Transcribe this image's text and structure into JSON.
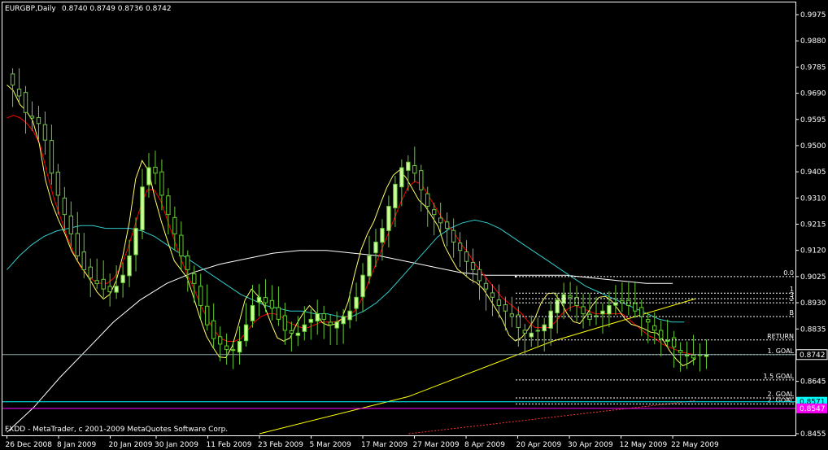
{
  "window": {
    "symbol_header": "EURGBP,Daily",
    "ohlc_header": "0.8740 0.8749 0.8736 0.8742",
    "copyright": "FXDD - MetaTrader, c 2001-2009 MetaQuotes Software Corp."
  },
  "colors": {
    "background": "#000000",
    "frame": "#ffffff",
    "bull_candle": "#ccff99",
    "bear_candle": "#000000",
    "wick": "#66cc33",
    "ma_red": "#ff0000",
    "ma_yellow": "#ffff66",
    "ma_cyan": "#33cccc",
    "ma_white": "#ffffff",
    "ma_long": "#ffff00",
    "bid_line": "#8aa5a5",
    "level_price_bg": "#00ffff",
    "level_magenta": "#ff00ff",
    "fib_line": "#ffffff",
    "projection": "#ff3333"
  },
  "chart_data": {
    "type": "candlestick",
    "symbol": "EURGBP",
    "timeframe": "Daily",
    "y_ticks": [
      0.9975,
      0.988,
      0.9785,
      0.969,
      0.9595,
      0.95,
      0.9405,
      0.931,
      0.9215,
      0.912,
      0.9025,
      0.893,
      0.8835,
      0.8645,
      0.8455
    ],
    "y_tick_labels": [
      "0.9975",
      "0.9880",
      "0.9785",
      "0.9690",
      "0.9595",
      "0.9500",
      "0.9405",
      "0.9310",
      "0.9215",
      "0.9120",
      "0.9025",
      "0.8930",
      "0.8835",
      "0.8645",
      "0.8455"
    ],
    "ylim": [
      0.8455,
      0.9995
    ],
    "x_labels": [
      "26 Dec 2008",
      "8 Jan 2009",
      "20 Jan 2009",
      "30 Jan 2009",
      "11 Feb 2009",
      "23 Feb 2009",
      "5 Mar 2009",
      "17 Mar 2009",
      "27 Mar 2009",
      "8 Apr 2009",
      "20 Apr 2009",
      "30 Apr 2009",
      "12 May 2009",
      "22 May 2009"
    ],
    "x_label_bars": [
      0,
      9,
      18,
      26,
      35,
      44,
      53,
      62,
      71,
      80,
      89,
      98,
      107,
      116
    ],
    "bar_count": 124,
    "close": [
      0.972,
      0.968,
      0.962,
      0.96,
      0.958,
      0.952,
      0.94,
      0.932,
      0.925,
      0.918,
      0.91,
      0.905,
      0.902,
      0.9,
      0.898,
      0.897,
      0.899,
      0.903,
      0.91,
      0.92,
      0.935,
      0.942,
      0.94,
      0.932,
      0.925,
      0.918,
      0.91,
      0.905,
      0.9,
      0.892,
      0.885,
      0.88,
      0.878,
      0.876,
      0.876,
      0.879,
      0.885,
      0.892,
      0.895,
      0.893,
      0.891,
      0.887,
      0.883,
      0.882,
      0.882,
      0.885,
      0.887,
      0.889,
      0.887,
      0.885,
      0.886,
      0.888,
      0.89,
      0.895,
      0.903,
      0.91,
      0.915,
      0.92,
      0.928,
      0.936,
      0.942,
      0.944,
      0.94,
      0.934,
      0.928,
      0.925,
      0.922,
      0.92,
      0.915,
      0.912,
      0.908,
      0.905,
      0.901,
      0.898,
      0.895,
      0.892,
      0.89,
      0.888,
      0.884,
      0.882,
      0.882,
      0.883,
      0.885,
      0.89,
      0.894,
      0.896,
      0.895,
      0.892,
      0.889,
      0.887,
      0.888,
      0.89,
      0.892,
      0.893,
      0.893,
      0.892,
      0.89,
      0.888,
      0.886,
      0.883,
      0.88,
      0.879,
      0.877,
      0.875,
      0.874,
      0.873,
      0.874,
      0.8742
    ],
    "ma_red": [
      0.96,
      0.961,
      0.96,
      0.958,
      0.955,
      0.95,
      0.94,
      0.931,
      0.924,
      0.917,
      0.911,
      0.906,
      0.903,
      0.901,
      0.9,
      0.9,
      0.902,
      0.906,
      0.912,
      0.92,
      0.928,
      0.934,
      0.934,
      0.93,
      0.923,
      0.916,
      0.909,
      0.903,
      0.898,
      0.892,
      0.887,
      0.883,
      0.88,
      0.879,
      0.879,
      0.88,
      0.883,
      0.886,
      0.888,
      0.889,
      0.889,
      0.888,
      0.886,
      0.885,
      0.884,
      0.884,
      0.885,
      0.886,
      0.886,
      0.886,
      0.887,
      0.888,
      0.89,
      0.894,
      0.9,
      0.906,
      0.912,
      0.918,
      0.924,
      0.93,
      0.935,
      0.937,
      0.936,
      0.932,
      0.928,
      0.924,
      0.921,
      0.918,
      0.914,
      0.911,
      0.907,
      0.904,
      0.901,
      0.898,
      0.895,
      0.893,
      0.891,
      0.889,
      0.886,
      0.884,
      0.884,
      0.884,
      0.886,
      0.889,
      0.891,
      0.892,
      0.891,
      0.89,
      0.889,
      0.889,
      0.889,
      0.889,
      0.889,
      0.887,
      0.885,
      0.883,
      0.881,
      0.88,
      0.878,
      0.877,
      0.876,
      0.875,
      0.8745,
      0.8742
    ],
    "ma_cyan": [
      0.905,
      0.91,
      0.914,
      0.917,
      0.919,
      0.92,
      0.921,
      0.921,
      0.92,
      0.92,
      0.92,
      0.919,
      0.917,
      0.914,
      0.911,
      0.908,
      0.905,
      0.902,
      0.899,
      0.896,
      0.894,
      0.892,
      0.891,
      0.89,
      0.89,
      0.889,
      0.889,
      0.888,
      0.888,
      0.89,
      0.893,
      0.897,
      0.902,
      0.907,
      0.912,
      0.917,
      0.92,
      0.922,
      0.923,
      0.922,
      0.92,
      0.917,
      0.914,
      0.911,
      0.908,
      0.905,
      0.902,
      0.899,
      0.897,
      0.895,
      0.893,
      0.891,
      0.889,
      0.887,
      0.886,
      0.886
    ],
    "ma_white": [
      0.846,
      0.855,
      0.866,
      0.876,
      0.886,
      0.894,
      0.9,
      0.904,
      0.907,
      0.909,
      0.911,
      0.912,
      0.912,
      0.911,
      0.91,
      0.908,
      0.906,
      0.904,
      0.903,
      0.903,
      0.903,
      0.903,
      0.902,
      0.901,
      0.9,
      0.9
    ],
    "fib_levels": [
      {
        "label": "0.0",
        "price": 0.9025
      },
      {
        "label": "1",
        "price": 0.8965
      },
      {
        "label": "3",
        "price": 0.8945
      },
      {
        "label": "2",
        "price": 0.893
      },
      {
        "label": "B",
        "price": 0.888
      },
      {
        "label": "RETURN",
        "price": 0.8795
      },
      {
        "label": "1. GOAL",
        "price": 0.8742
      },
      {
        "label": "1.5 GOAL",
        "price": 0.865
      },
      {
        "label": "2. GOAL",
        "price": 0.8585
      },
      {
        "label": "2. GOAL",
        "price": 0.8563
      }
    ],
    "current_price": "0.8742",
    "level_cyan_price": "0.8571",
    "level_magenta_price": "0.8547"
  }
}
